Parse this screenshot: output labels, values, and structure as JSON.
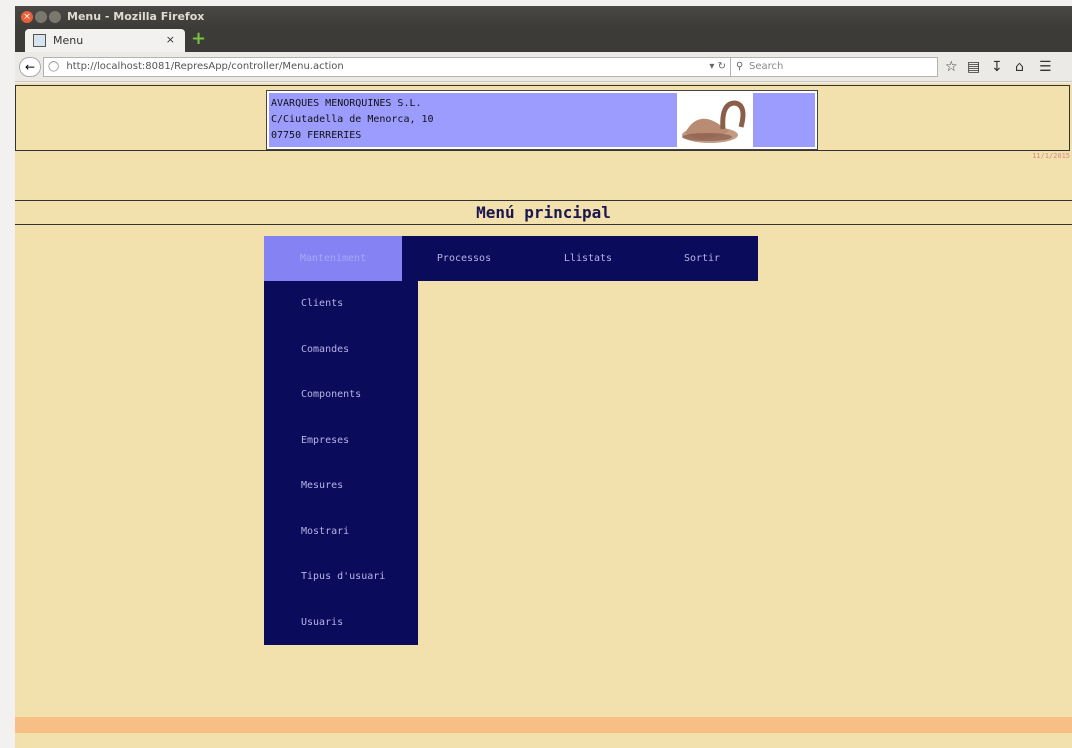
{
  "window": {
    "title": "Menu - Mozilla Firefox"
  },
  "tab": {
    "label": "Menu",
    "close": "×",
    "new_tab": "+"
  },
  "toolbar": {
    "url": "http://localhost:8081/RepresApp/controller/Menu.action",
    "search_placeholder": "Search",
    "icons": [
      "back-icon",
      "identity-icon",
      "globe-icon",
      "reload-icon",
      "search-icon",
      "bookmark-star-icon",
      "reading-list-icon",
      "downloads-icon",
      "home-icon",
      "hamburger-menu-icon"
    ]
  },
  "header": {
    "company_line1": "AVARQUES MENORQUINES S.L.",
    "company_line2": "C/Ciutadella de Menorca, 10",
    "company_line3": "07750 FERRERIES",
    "date": "11/1/2015"
  },
  "page": {
    "title": "Menú principal"
  },
  "menu": {
    "items": [
      {
        "label": "Manteniment",
        "active": true
      },
      {
        "label": "Processos",
        "active": false
      },
      {
        "label": "Llistats",
        "active": false
      },
      {
        "label": "Sortir",
        "active": false
      }
    ],
    "submenu": [
      "Clients",
      "Comandes",
      "Components",
      "Empreses",
      "Mesures",
      "Mostrari",
      "Tipus d'usuari",
      "Usuaris"
    ]
  },
  "colors": {
    "page_bg": "#f3e1ad",
    "menu_bg": "#0b0b5c",
    "menu_active": "#8583f4",
    "header_bg": "#9c9cff",
    "footer": "#f7bf86"
  }
}
